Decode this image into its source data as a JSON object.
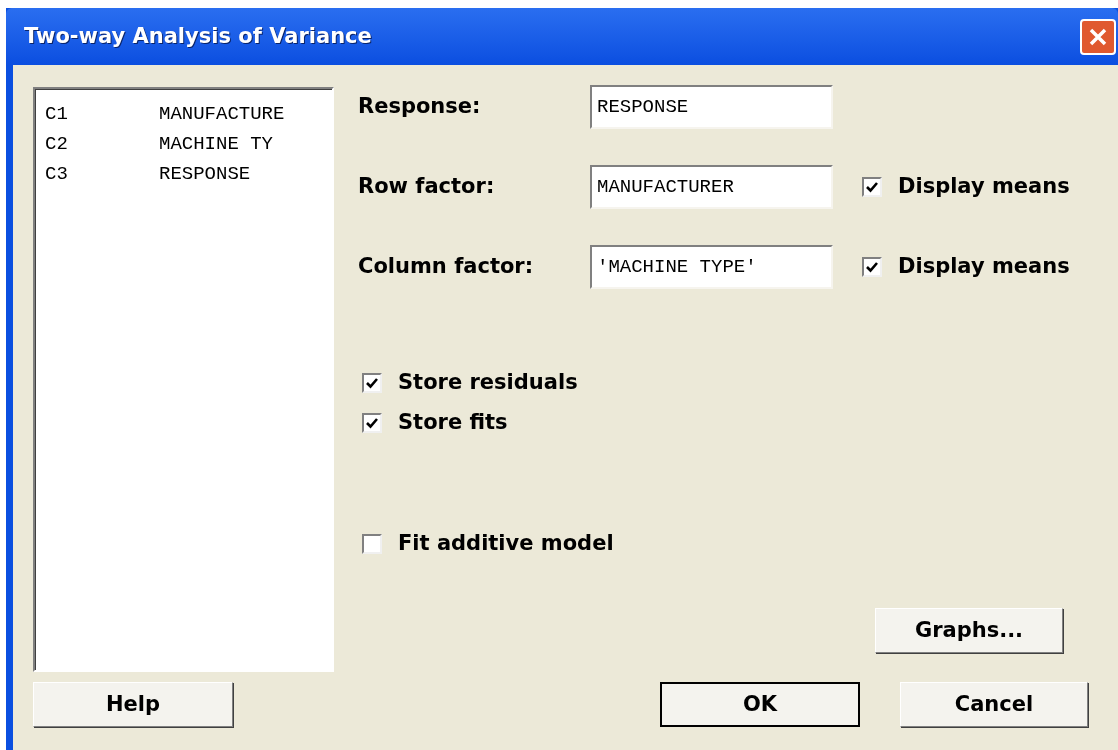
{
  "window": {
    "title": "Two-way Analysis of Variance"
  },
  "variables": [
    {
      "column": "C1",
      "name": "MANUFACTURE"
    },
    {
      "column": "C2",
      "name": "MACHINE TY"
    },
    {
      "column": "C3",
      "name": "RESPONSE"
    }
  ],
  "fields": [
    {
      "label": "Response:",
      "value": "RESPONSE"
    },
    {
      "label": "Row factor:",
      "value": "MANUFACTURER",
      "display_means": {
        "label": "Display means",
        "checked": true
      }
    },
    {
      "label": "Column factor:",
      "value": "'MACHINE TYPE'",
      "display_means": {
        "label": "Display means",
        "checked": true
      }
    }
  ],
  "storage": [
    {
      "label": "Store residuals",
      "checked": true
    },
    {
      "label": "Store fits",
      "checked": true
    }
  ],
  "model_options": [
    {
      "label": "Fit additive model",
      "checked": false
    }
  ],
  "buttons": {
    "graphs": "Graphs...",
    "help": "Help",
    "ok": "OK",
    "cancel": "Cancel"
  }
}
